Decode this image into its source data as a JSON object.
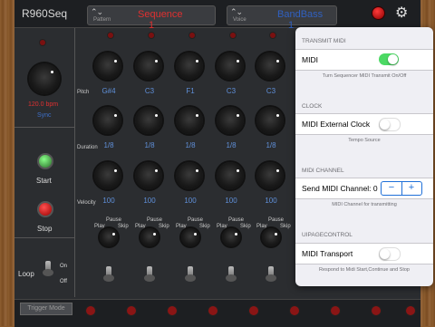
{
  "app": {
    "title": "R960Seq"
  },
  "header": {
    "pattern": {
      "caption": "Pattern",
      "value": "Sequence 1"
    },
    "voice": {
      "caption": "Voice",
      "value": "BandBass 1"
    }
  },
  "left": {
    "tempo": "120.0 bpm",
    "sync": "Sync",
    "start": "Start",
    "stop": "Stop",
    "loop": "Loop",
    "on": "On",
    "off": "Off"
  },
  "rows": {
    "pitch": {
      "label": "Pitch",
      "values": [
        "G#4",
        "C3",
        "F1",
        "C3",
        "C3"
      ]
    },
    "duration": {
      "label": "Duration",
      "values": [
        "1/8",
        "1/8",
        "1/8",
        "1/8",
        "1/8"
      ]
    },
    "velocity": {
      "label": "Velocity",
      "values": [
        "100",
        "100",
        "100",
        "100",
        "100"
      ]
    },
    "mode": {
      "pause": "Pause",
      "play": "Play",
      "skip": "Skip"
    }
  },
  "bottom": {
    "trigger_mode": "Trigger Mode"
  },
  "settings": {
    "transmit_midi": {
      "header": "TRANSMIT MIDI",
      "label": "MIDI",
      "footer": "Turn Sequencer MIDI Transmit On/Off",
      "on": true
    },
    "clock": {
      "header": "CLOCK",
      "label": "MIDI External Clock",
      "footer": "Tempo Source",
      "on": false
    },
    "channel": {
      "header": "MIDI CHANNEL",
      "label": "Send MIDI Channel: 0",
      "footer": "MIDI Channel for transmitting",
      "minus": "−",
      "plus": "+"
    },
    "upage": {
      "header": "UIPAGECONTROL",
      "label": "MIDI Transport",
      "footer": "Respond to Midi Start,Continue and Stop",
      "on": false
    }
  },
  "colors": {
    "accent": "#1e6fd8",
    "switch_on": "#4cd964",
    "led_red": "#d22020",
    "value_blue": "#5f8fd8"
  }
}
